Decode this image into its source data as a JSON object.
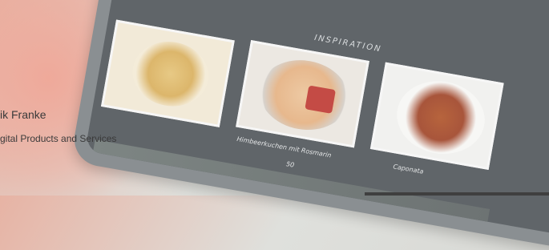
{
  "speaker": {
    "name": "ik Franke",
    "role": "gital Products and Services"
  },
  "tablet": {
    "section_title": "INSPIRATION",
    "cards": [
      {
        "name": "card-left",
        "caption": "",
        "number": ""
      },
      {
        "name": "card-himbeerkuchen",
        "caption": "Himbeerkuchen mit Rosmarin",
        "number": "50"
      },
      {
        "name": "card-caponata",
        "caption": "Caponata",
        "number": ""
      }
    ]
  }
}
